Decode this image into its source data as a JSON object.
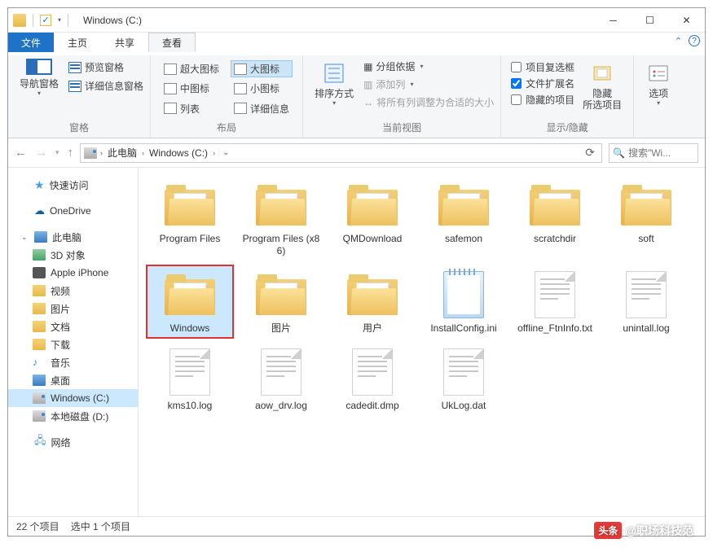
{
  "title": "Windows (C:)",
  "tabs": {
    "file": "文件",
    "home": "主页",
    "share": "共享",
    "view": "查看"
  },
  "ribbon": {
    "group_panes": {
      "nav": "导航窗格",
      "preview": "预览窗格",
      "details": "详细信息窗格",
      "label": "窗格"
    },
    "group_layout": {
      "extra_large": "超大图标",
      "large": "大图标",
      "medium": "中图标",
      "small": "小图标",
      "list": "列表",
      "details": "详细信息",
      "label": "布局"
    },
    "group_view": {
      "sort": "排序方式",
      "group_by": "分组依据",
      "add_cols": "添加列",
      "fit_cols": "将所有列调整为合适的大小",
      "label": "当前视图"
    },
    "group_showhide": {
      "checkboxes": "项目复选框",
      "extensions": "文件扩展名",
      "hidden_items": "隐藏的项目",
      "hide": "隐藏\n所选项目",
      "label": "显示/隐藏"
    },
    "group_options": {
      "options": "选项"
    }
  },
  "address": {
    "root": "此电脑",
    "drive": "Windows (C:)",
    "search_placeholder": "搜索\"Wi..."
  },
  "tree": {
    "quick": "快速访问",
    "onedrive": "OneDrive",
    "this_pc": "此电脑",
    "obj3d": "3D 对象",
    "iphone": "Apple iPhone",
    "videos": "视频",
    "pictures": "图片",
    "documents": "文档",
    "downloads": "下载",
    "music": "音乐",
    "desktop": "桌面",
    "drive_c": "Windows (C:)",
    "drive_d": "本地磁盘 (D:)",
    "network": "网络"
  },
  "files": [
    {
      "name": "Program Files",
      "type": "folder"
    },
    {
      "name": "Program Files (x86)",
      "type": "folder"
    },
    {
      "name": "QMDownload",
      "type": "folder"
    },
    {
      "name": "safemon",
      "type": "folder"
    },
    {
      "name": "scratchdir",
      "type": "folder"
    },
    {
      "name": "soft",
      "type": "folder"
    },
    {
      "name": "Windows",
      "type": "folder-system",
      "selected": true,
      "highlight": true
    },
    {
      "name": "图片",
      "type": "folder"
    },
    {
      "name": "用户",
      "type": "folder"
    },
    {
      "name": "InstallConfig.ini",
      "type": "ini"
    },
    {
      "name": "offline_FtnInfo.txt",
      "type": "text"
    },
    {
      "name": "unintall.log",
      "type": "text"
    },
    {
      "name": "kms10.log",
      "type": "text"
    },
    {
      "name": "aow_drv.log",
      "type": "text"
    },
    {
      "name": "cadedit.dmp",
      "type": "text"
    },
    {
      "name": "UkLog.dat",
      "type": "text"
    }
  ],
  "status": {
    "count": "22 个项目",
    "selected": "选中 1 个项目"
  },
  "watermark": {
    "badge": "头条",
    "text": "@职场科技范"
  }
}
